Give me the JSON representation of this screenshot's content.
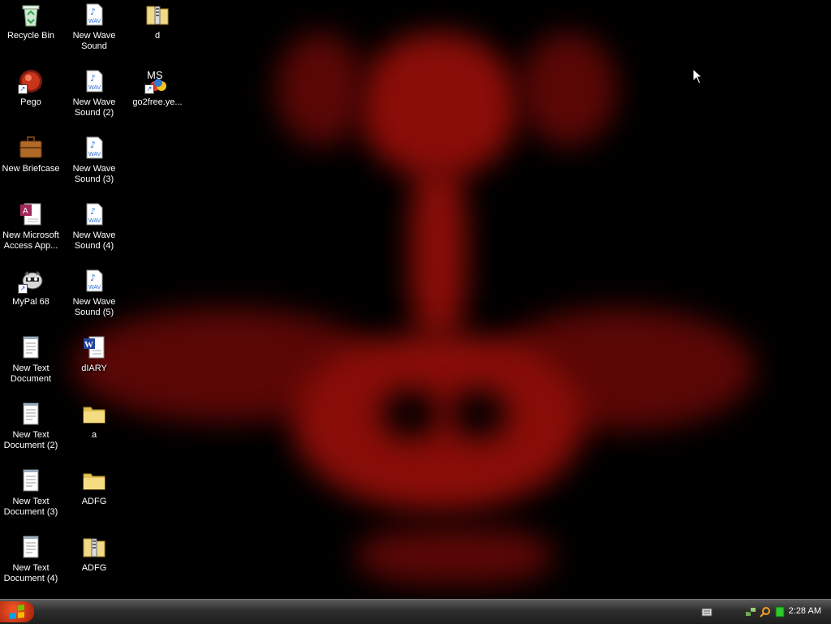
{
  "desktop": {
    "icons": [
      {
        "label": "Recycle Bin",
        "icon": "recycle-bin-icon"
      },
      {
        "label": "Pego",
        "icon": "pego-app-icon"
      },
      {
        "label": "New Briefcase",
        "icon": "briefcase-icon"
      },
      {
        "label": "New Microsoft Access App...",
        "icon": "access-app-icon"
      },
      {
        "label": "MyPal 68",
        "icon": "mypal-browser-icon"
      },
      {
        "label": "New Text Document",
        "icon": "text-document-icon"
      },
      {
        "label": "New Text Document (2)",
        "icon": "text-document-icon"
      },
      {
        "label": "New Text Document (3)",
        "icon": "text-document-icon"
      },
      {
        "label": "New Text Document (4)",
        "icon": "text-document-icon"
      },
      {
        "label": "New Wave Sound",
        "icon": "wav-file-icon"
      },
      {
        "label": "New Wave Sound (2)",
        "icon": "wav-file-icon"
      },
      {
        "label": "New Wave Sound (3)",
        "icon": "wav-file-icon"
      },
      {
        "label": "New Wave Sound (4)",
        "icon": "wav-file-icon"
      },
      {
        "label": "New Wave Sound (5)",
        "icon": "wav-file-icon"
      },
      {
        "label": "dIARY",
        "icon": "word-document-icon"
      },
      {
        "label": "a",
        "icon": "folder-icon"
      },
      {
        "label": "ADFG",
        "icon": "folder-icon"
      },
      {
        "label": "ADFG",
        "icon": "zip-folder-icon"
      },
      {
        "label": "d",
        "icon": "zip-folder-icon"
      },
      {
        "label": "go2free.ye...",
        "icon": "msn-shortcut-icon"
      }
    ],
    "wav_badge": "WAV",
    "msn_badge": "MS"
  },
  "taskbar": {
    "clock": "2:28 AM",
    "tray_icons": [
      "keyboard-icon",
      "network-icon",
      "search-icon",
      "battery-icon"
    ]
  },
  "colors": {
    "wallpaper_red": "#8a0d08",
    "start_button": "#d2401a",
    "taskbar": "#2e2e2e"
  }
}
